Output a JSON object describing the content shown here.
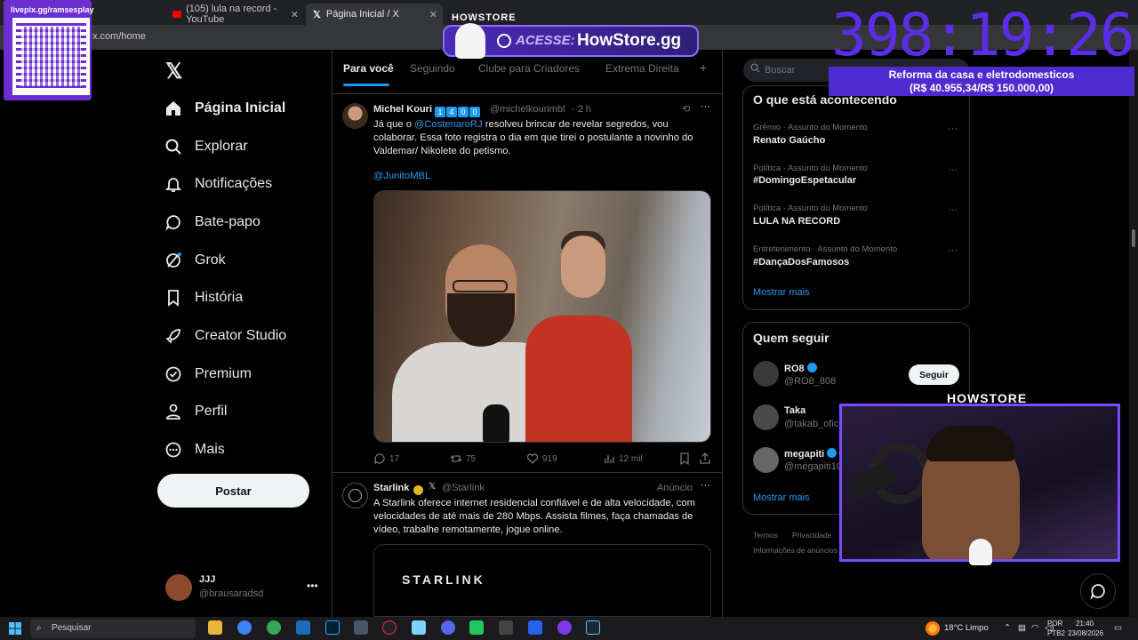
{
  "browser": {
    "tabs": [
      {
        "title": "livepix.gg/ramsesplay"
      },
      {
        "title": "(105) lula na record - YouTube"
      },
      {
        "title": "Página Inicial / X"
      }
    ],
    "url": "x.com/home"
  },
  "nav": {
    "items": [
      {
        "label": "Página Inicial",
        "icon": "home-icon"
      },
      {
        "label": "Explorar",
        "icon": "search-icon"
      },
      {
        "label": "Notificações",
        "icon": "bell-icon"
      },
      {
        "label": "Bate-papo",
        "icon": "chat-icon"
      },
      {
        "label": "Grok",
        "icon": "grok-icon"
      },
      {
        "label": "História",
        "icon": "bookmark-icon"
      },
      {
        "label": "Creator Studio",
        "icon": "rocket-icon"
      },
      {
        "label": "Premium",
        "icon": "premium-icon"
      },
      {
        "label": "Perfil",
        "icon": "person-icon"
      },
      {
        "label": "Mais",
        "icon": "more-circle-icon"
      }
    ],
    "post_button": "Postar",
    "account": {
      "name": "JJJ",
      "handle": "@brausaradsd"
    }
  },
  "feed": {
    "tabs": [
      "Para você",
      "Seguindo",
      "Clube para Criadores",
      "Extrema Direita"
    ],
    "tweets": [
      {
        "name": "Michel Kouri",
        "badges": [
          "1",
          "4",
          "0",
          "0"
        ],
        "handle": "@michelkourimbl",
        "time": "· 2 h",
        "mention": "@CostenaroRJ",
        "text_pre": "Já que o ",
        "text_post": " resolveu brincar de revelar segredos, vou colaborar. Essa foto registra o dia em que tirei o postulante a novinho do Valdemar/ Nikolete do petismo.",
        "mention2": "@JunitoMBL",
        "replies": "17",
        "retweets": "75",
        "likes": "919",
        "views": "12 mil"
      },
      {
        "name": "Starlink",
        "handle": "@Starlink",
        "ad_label": "Anúncio",
        "text": "A Starlink oferece internet residencial confiável e de alta velocidade, com velocidades de até mais de 280 Mbps. Assista filmes, faça chamadas de vídeo, trabalhe remotamente, jogue online.",
        "card_word": "STARLINK"
      }
    ]
  },
  "right": {
    "search_placeholder": "Buscar",
    "trends_title": "O que está acontecendo",
    "trends": [
      {
        "category": "Grêmio · Assunto do Momento",
        "name": "Renato Gaúcho"
      },
      {
        "category": "Política · Assunto do Momento",
        "name": "#DomingoEspetacular"
      },
      {
        "category": "Política · Assunto do Momento",
        "name": "LULA NA RECORD"
      },
      {
        "category": "Entretenimento · Assunto do Momento",
        "name": "#DançaDosFamosos"
      }
    ],
    "show_more": "Mostrar mais",
    "who_title": "Quem seguir",
    "who": [
      {
        "name": "RO8",
        "handle": "@RO8_808"
      },
      {
        "name": "Taka",
        "handle": "@takab_ofici"
      },
      {
        "name": "megapiti",
        "handle": "@megapiti10"
      }
    ],
    "follow_label": "Seguir",
    "footer": [
      "Termos",
      "Privacidade",
      "Informações de anúncios"
    ]
  },
  "overlay": {
    "qr_label": "livepix.gg/ramsesplay",
    "acesse": "ACESSE:",
    "site": "HowStore.gg",
    "logo": "HOWSTORE",
    "timer": "398:19:26",
    "reform_line1": "Reforma da casa e eletrodomesticos",
    "reform_line2": "(R$ 40.955,34/R$ 150.000,00)",
    "cam_title": "HOWSTORE"
  },
  "taskbar": {
    "search": "Pesquisar",
    "weather": "18°C  Limpo",
    "lang1": "POR",
    "lang2": "PTB2",
    "time": "21:40",
    "date": "23/08/2026"
  },
  "colors": {
    "accent": "#1d9bf0",
    "background": "#000000",
    "overlay_purple": "#5b2de8"
  }
}
